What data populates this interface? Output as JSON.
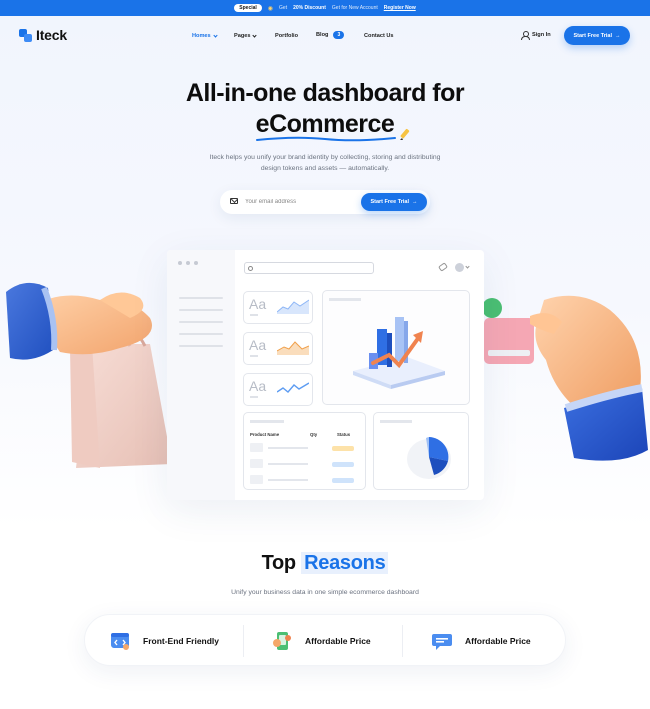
{
  "announcement": {
    "pill": "Special",
    "icon": "tag-icon",
    "discount_prefix": "Get",
    "discount_value": "20% Discount",
    "discount_suffix": "Get for New Account",
    "link": "Register Now"
  },
  "nav": {
    "logo": "Iteck",
    "items": [
      {
        "label": "Homes",
        "has_dropdown": true,
        "active": true
      },
      {
        "label": "Pages",
        "has_dropdown": true,
        "active": false
      },
      {
        "label": "Portfolio",
        "has_dropdown": false,
        "active": false
      },
      {
        "label": "Blog",
        "badge": "3",
        "active": false
      },
      {
        "label": "Contact Us",
        "has_dropdown": false,
        "active": false
      }
    ],
    "signin": "Sign In",
    "cta": "Start Free Trial"
  },
  "hero": {
    "title_line1": "All-in-one dashboard for",
    "title_line2": "eCommerce",
    "subtitle": "Iteck helps you unify your brand identity by collecting, storing and distributing design tokens and assets — automatically.",
    "email_placeholder": "Your email address",
    "cta": "Start Free Trial"
  },
  "dashboard": {
    "aa_label": "Aa",
    "table_headers": [
      "Product Name",
      "Qty",
      "Status"
    ],
    "spark_colors": [
      "#8fb7f6",
      "#f5b36b",
      "#5d9cf2"
    ],
    "status_colors": [
      "#fde2a9",
      "#cfe3fb",
      "#cfe3fb"
    ]
  },
  "reasons_section": {
    "title_part1": "Top",
    "title_part2": "Reasons",
    "subtitle": "Unify your business data in one simple ecommerce dashboard",
    "items": [
      {
        "label": "Front-End Friendly",
        "icon": "code-window-icon"
      },
      {
        "label": "Affordable Price",
        "icon": "wallet-phone-icon"
      },
      {
        "label": "Affordable Price",
        "icon": "chat-bubble-icon"
      }
    ]
  },
  "colors": {
    "brand": "#1a73e8",
    "text": "#111111",
    "muted": "#6b7280"
  }
}
